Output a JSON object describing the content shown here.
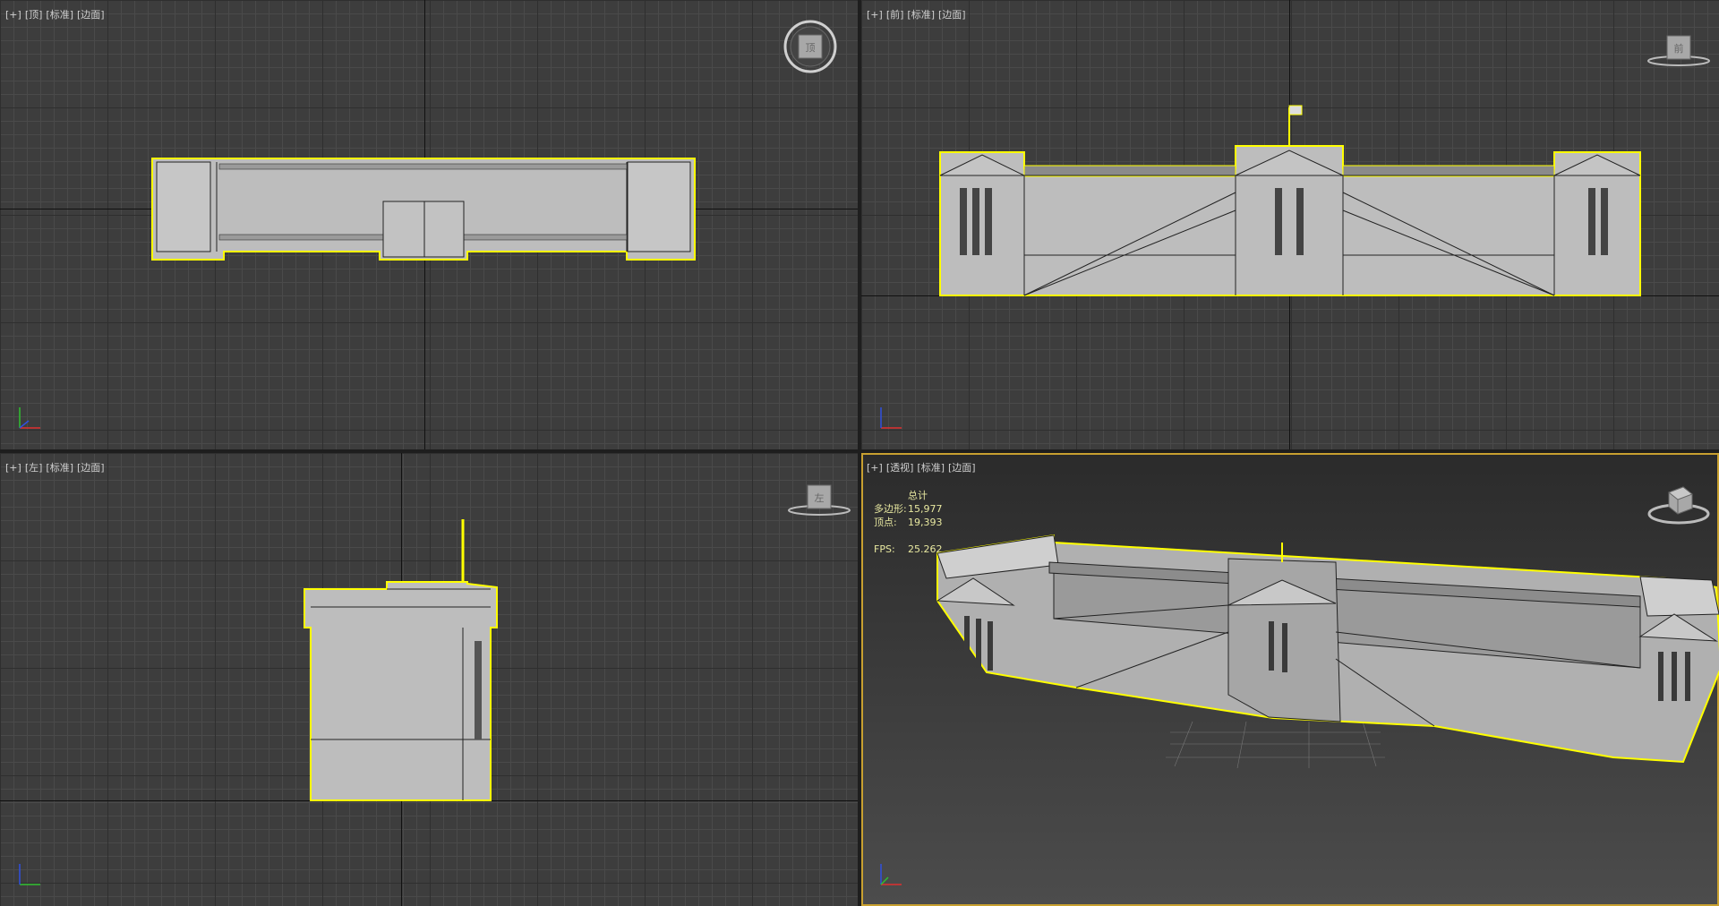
{
  "viewports": {
    "top": {
      "labels": [
        "[+]",
        "[顶]",
        "[标准]",
        "[边面]"
      ]
    },
    "front": {
      "labels": [
        "[+]",
        "[前]",
        "[标准]",
        "[边面]"
      ]
    },
    "left": {
      "labels": [
        "[+]",
        "[左]",
        "[标准]",
        "[边面]"
      ]
    },
    "perspective": {
      "labels": [
        "[+]",
        "[透视]",
        "[标准]",
        "[边面]"
      ]
    }
  },
  "stats": {
    "total_label": "总计",
    "poly_label": "多边形:",
    "poly_value": "15,977",
    "vert_label": "顶点:",
    "vert_value": "19,393",
    "fps_label": "FPS:",
    "fps_value": "25.262"
  },
  "viewcube": {
    "top_face": "顶",
    "front_face": "前",
    "left_face": "左"
  },
  "colors": {
    "selection": "#ffff00",
    "active_border": "#c8a030",
    "grid_bg": "#3d3d3d",
    "model": "#bdbdbd"
  }
}
